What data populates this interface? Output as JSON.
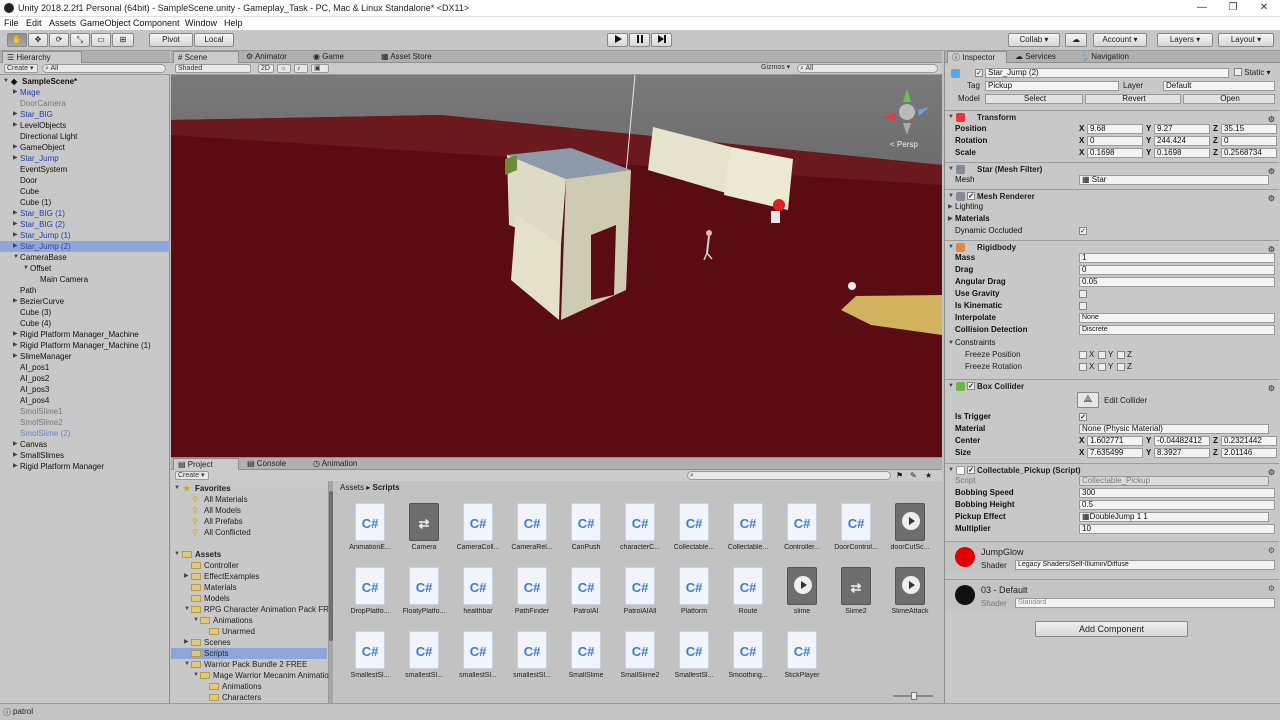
{
  "window": {
    "title": "Unity 2018.2.2f1 Personal (64bit) - SampleScene.unity - Gameplay_Task - PC, Mac & Linux Standalone* <DX11>",
    "minimize": "—",
    "maximize": "❐",
    "close": "✕"
  },
  "menu": [
    "File",
    "Edit",
    "Assets",
    "GameObject",
    "Component",
    "Window",
    "Help"
  ],
  "toolbar": {
    "pivot": "Pivot",
    "local": "Local",
    "collab": "Collab ▾",
    "account": "Account",
    "layers": "Layers",
    "layout": "Layout"
  },
  "hierarchy": {
    "tab": "Hierarchy",
    "create": "Create ▾",
    "search": "All",
    "scene": "SampleScene*",
    "items": [
      {
        "label": "Mage",
        "style": "prefab",
        "indent": 1,
        "arrow": true
      },
      {
        "label": "DoorCamera",
        "style": "dim",
        "indent": 1
      },
      {
        "label": "Star_BIG",
        "style": "prefab",
        "indent": 1,
        "arrow": true
      },
      {
        "label": "LevelObjects",
        "style": "normal",
        "indent": 1,
        "arrow": true
      },
      {
        "label": "Directional Light",
        "style": "normal",
        "indent": 1
      },
      {
        "label": "GameObject",
        "style": "normal",
        "indent": 1,
        "arrow": true
      },
      {
        "label": "Star_Jump",
        "style": "prefab",
        "indent": 1,
        "arrow": true
      },
      {
        "label": "EventSystem",
        "style": "normal",
        "indent": 1
      },
      {
        "label": "Door",
        "style": "normal",
        "indent": 1
      },
      {
        "label": "Cube",
        "style": "normal",
        "indent": 1
      },
      {
        "label": "Cube (1)",
        "style": "normal",
        "indent": 1
      },
      {
        "label": "Star_BIG (1)",
        "style": "prefab",
        "indent": 1,
        "arrow": true
      },
      {
        "label": "Star_BIG (2)",
        "style": "prefab",
        "indent": 1,
        "arrow": true
      },
      {
        "label": "Star_Jump (1)",
        "style": "prefab",
        "indent": 1,
        "arrow": true
      },
      {
        "label": "Star_Jump (2)",
        "style": "sel",
        "indent": 1,
        "arrow": true
      },
      {
        "label": "CameraBase",
        "style": "normal",
        "indent": 1,
        "arrow": true,
        "open": true
      },
      {
        "label": "Offset",
        "style": "normal",
        "indent": 2,
        "arrow": true,
        "open": true
      },
      {
        "label": "Main Camera",
        "style": "normal",
        "indent": 3
      },
      {
        "label": "Path",
        "style": "normal",
        "indent": 1
      },
      {
        "label": "BezierCurve",
        "style": "normal",
        "indent": 1,
        "arrow": true
      },
      {
        "label": "Cube (3)",
        "style": "normal",
        "indent": 1
      },
      {
        "label": "Cube (4)",
        "style": "normal",
        "indent": 1
      },
      {
        "label": "Rigid Platform Manager_Machine",
        "style": "normal",
        "indent": 1,
        "arrow": true
      },
      {
        "label": "Rigid Platform Manager_Machine (1)",
        "style": "normal",
        "indent": 1,
        "arrow": true
      },
      {
        "label": "SlimeManager",
        "style": "normal",
        "indent": 1,
        "arrow": true
      },
      {
        "label": "AI_pos1",
        "style": "normal",
        "indent": 1
      },
      {
        "label": "AI_pos2",
        "style": "normal",
        "indent": 1
      },
      {
        "label": "AI_pos3",
        "style": "normal",
        "indent": 1
      },
      {
        "label": "AI_pos4",
        "style": "normal",
        "indent": 1
      },
      {
        "label": "SmolSlime1",
        "style": "dim",
        "indent": 1
      },
      {
        "label": "SmolSlime2",
        "style": "dim",
        "indent": 1
      },
      {
        "label": "SmolSlime (2)",
        "style": "dimprefab",
        "indent": 1
      },
      {
        "label": "Canvas",
        "style": "normal",
        "indent": 1,
        "arrow": true
      },
      {
        "label": "SmallSlimes",
        "style": "normal",
        "indent": 1,
        "arrow": true
      },
      {
        "label": "Rigid Platform Manager",
        "style": "normal",
        "indent": 1,
        "arrow": true
      }
    ]
  },
  "scene": {
    "tabs": [
      "Scene",
      "Animator",
      "Game",
      "Asset Store"
    ],
    "shading": "Shaded",
    "mode2d": "2D",
    "gizmos": "Gizmos ▾",
    "search": "All",
    "persp": "< Persp"
  },
  "project": {
    "tabs": [
      "Project",
      "Console",
      "Animation"
    ],
    "create": "Create ▾",
    "tree": [
      {
        "label": "Favorites",
        "type": "fav-head",
        "indent": 0
      },
      {
        "label": "All Materials",
        "type": "fav",
        "indent": 1
      },
      {
        "label": "All Models",
        "type": "fav",
        "indent": 1
      },
      {
        "label": "All Prefabs",
        "type": "fav",
        "indent": 1
      },
      {
        "label": "All Conflicted",
        "type": "fav",
        "indent": 1
      },
      {
        "label": "",
        "type": "gap",
        "indent": 0
      },
      {
        "label": "Assets",
        "type": "head",
        "indent": 0
      },
      {
        "label": "Controller",
        "type": "folder",
        "indent": 1
      },
      {
        "label": "EffectExamples",
        "type": "folder",
        "indent": 1,
        "arrow": true
      },
      {
        "label": "Materials",
        "type": "folder",
        "indent": 1
      },
      {
        "label": "Models",
        "type": "folder",
        "indent": 1
      },
      {
        "label": "RPG Character Animation Pack FREE",
        "type": "folder",
        "indent": 1,
        "arrow": true,
        "open": true
      },
      {
        "label": "Animations",
        "type": "folder",
        "indent": 2,
        "arrow": true,
        "open": true
      },
      {
        "label": "Unarmed",
        "type": "folder",
        "indent": 3
      },
      {
        "label": "Scenes",
        "type": "folder",
        "indent": 1,
        "arrow": true
      },
      {
        "label": "Scripts",
        "type": "folder",
        "indent": 1,
        "sel": true
      },
      {
        "label": "Warrior Pack Bundle 2 FREE",
        "type": "folder",
        "indent": 1,
        "arrow": true,
        "open": true
      },
      {
        "label": "Mage Warrior Mecanim Animation",
        "type": "folder",
        "indent": 2,
        "arrow": true,
        "open": true
      },
      {
        "label": "Animations",
        "type": "folder",
        "indent": 3
      },
      {
        "label": "Characters",
        "type": "folder",
        "indent": 3
      }
    ],
    "breadcrumb": [
      "Assets",
      "Scripts"
    ],
    "assets": [
      {
        "label": "AnimationE...",
        "kind": "cs"
      },
      {
        "label": "Camera",
        "kind": "dark"
      },
      {
        "label": "CameraColl...",
        "kind": "cs"
      },
      {
        "label": "CameraRel...",
        "kind": "cs"
      },
      {
        "label": "CanPush",
        "kind": "cs"
      },
      {
        "label": "characterC...",
        "kind": "cs"
      },
      {
        "label": "Collectable...",
        "kind": "cs"
      },
      {
        "label": "Collectable...",
        "kind": "cs"
      },
      {
        "label": "Controller...",
        "kind": "cs"
      },
      {
        "label": "DoorControl...",
        "kind": "cs"
      },
      {
        "label": "doorCutSc...",
        "kind": "play"
      },
      {
        "label": "DropPlatfo...",
        "kind": "cs"
      },
      {
        "label": "FloatyPlatfo...",
        "kind": "cs"
      },
      {
        "label": "healthbar",
        "kind": "cs"
      },
      {
        "label": "PathFinder",
        "kind": "cs"
      },
      {
        "label": "PatrolAI",
        "kind": "cs"
      },
      {
        "label": "PatrolAIAll",
        "kind": "cs"
      },
      {
        "label": "Platform",
        "kind": "cs"
      },
      {
        "label": "Route",
        "kind": "cs"
      },
      {
        "label": "slime",
        "kind": "play"
      },
      {
        "label": "Slime2",
        "kind": "dark"
      },
      {
        "label": "SlimeAttack",
        "kind": "play"
      },
      {
        "label": "SmallestSl...",
        "kind": "cs"
      },
      {
        "label": "smallestSl...",
        "kind": "cs"
      },
      {
        "label": "smallestSl...",
        "kind": "cs"
      },
      {
        "label": "smallestSl...",
        "kind": "cs"
      },
      {
        "label": "SmallSlime",
        "kind": "cs"
      },
      {
        "label": "SmallSlime2",
        "kind": "cs"
      },
      {
        "label": "SmallestSl...",
        "kind": "cs"
      },
      {
        "label": "Smoothing...",
        "kind": "cs"
      },
      {
        "label": "StickPlayer",
        "kind": "cs"
      }
    ]
  },
  "inspector": {
    "tabs": [
      "Inspector",
      "Services",
      "Navigation"
    ],
    "object_name": "Star_Jump (2)",
    "static": "Static ▾",
    "tag_label": "Tag",
    "tag": "Pickup",
    "layer_label": "Layer",
    "layer": "Default",
    "model_label": "Model",
    "select": "Select",
    "revert": "Revert",
    "open": "Open",
    "transform": {
      "title": "Transform",
      "position_label": "Position",
      "position": [
        "9.68",
        "9.27",
        "35.15"
      ],
      "rotation_label": "Rotation",
      "rotation": [
        "0",
        "244.424",
        "0"
      ],
      "scale_label": "Scale",
      "scale": [
        "0.1698",
        "0.1698",
        "0.2568734"
      ]
    },
    "mesh_filter": {
      "title": "Star (Mesh Filter)",
      "mesh_label": "Mesh",
      "mesh": "Star"
    },
    "mesh_renderer": {
      "title": "Mesh Renderer",
      "lighting": "Lighting",
      "materials": "Materials",
      "dyn_label": "Dynamic Occluded",
      "dyn": "✓"
    },
    "rigidbody": {
      "title": "Rigidbody",
      "mass_label": "Mass",
      "mass": "1",
      "drag_label": "Drag",
      "drag": "0",
      "adrag_label": "Angular Drag",
      "adrag": "0.05",
      "gravity_label": "Use Gravity",
      "kinematic_label": "Is Kinematic",
      "interp_label": "Interpolate",
      "interp": "None",
      "coll_label": "Collision Detection",
      "coll": "Discrete",
      "constraints": "Constraints",
      "fpos": "Freeze Position",
      "frot": "Freeze Rotation"
    },
    "box_collider": {
      "title": "Box Collider",
      "edit": "Edit Collider",
      "trigger_label": "Is Trigger",
      "trigger": "✓",
      "material_label": "Material",
      "material": "None (Physic Material)",
      "center_label": "Center",
      "center": [
        "1.602771",
        "-0.04482412",
        "0.2321442"
      ],
      "size_label": "Size",
      "size": [
        "7.635499",
        "8.3927",
        "2.01146"
      ]
    },
    "script_comp": {
      "title": "Collectable_Pickup (Script)",
      "script_label": "Script",
      "script": "Collectable_Pickup",
      "bspeed_label": "Bobbing Speed",
      "bspeed": "300",
      "bheight_label": "Bobbing Height",
      "bheight": "0.5",
      "effect_label": "Pickup Effect",
      "effect": "DoubleJump 1 1",
      "mult_label": "Multiplier",
      "mult": "10"
    },
    "mat1": {
      "name": "JumpGlow",
      "shader_label": "Shader",
      "shader": "Legacy Shaders/Self-Illumin/Diffuse",
      "color": "#e00000"
    },
    "mat2": {
      "name": "03 - Default",
      "shader_label": "Shader",
      "shader": "Standard",
      "color": "#111111"
    },
    "add_component": "Add Component"
  },
  "status": {
    "text": "patrol"
  },
  "colors": {
    "accent_selection": "#8ea7d8",
    "floor": "#5a0c12",
    "prefab_text": "#1c3fb0"
  }
}
